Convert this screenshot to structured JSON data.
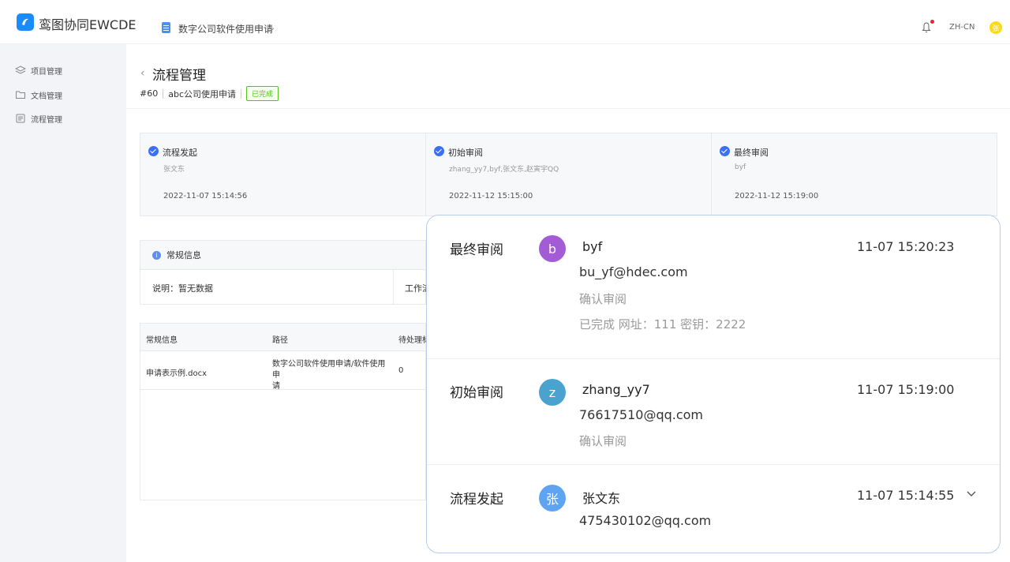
{
  "header": {
    "app_title": "鸾图协同EWCDE",
    "project_name": "数字公司软件使用申请",
    "lang": "ZH-CN",
    "avatar_text": "张"
  },
  "sidebar": {
    "items": [
      {
        "label": "项目管理",
        "icon": "layers-icon"
      },
      {
        "label": "文档管理",
        "icon": "folder-icon"
      },
      {
        "label": "流程管理",
        "icon": "process-icon"
      }
    ]
  },
  "page": {
    "title": "流程管理",
    "id": "#60",
    "name": "abc公司使用申请",
    "status": "已完成"
  },
  "steps": [
    {
      "name": "流程发起",
      "users": "张文东",
      "time": "2022-11-07 15:14:56"
    },
    {
      "name": "初始审阅",
      "users": "zhang_yy7,byf,张文东,赵寅宇QQ",
      "time": "2022-11-12 15:15:00"
    },
    {
      "name": "最终审阅",
      "users": "byf",
      "time": "2022-11-12 15:19:00"
    }
  ],
  "info": {
    "title": "常规信息",
    "desc": "说明：暂无数据",
    "work": "工作流"
  },
  "table": {
    "headers": [
      "常规信息",
      "路径",
      "待处理标"
    ],
    "rows": [
      {
        "name": "申请表示例.docx",
        "path_line1": "数字公司软件使用申请/软件使用申",
        "path_line2": "请",
        "count": "0"
      }
    ]
  },
  "popover": {
    "items": [
      {
        "stage": "最终审阅",
        "avatar": "b",
        "avatar_color": "#a35bd6",
        "user": "byf",
        "time": "11-07 15:20:23",
        "email": "bu_yf@hdec.com",
        "note1": "确认审阅",
        "note2": "已完成 网址：111 密钥：2222"
      },
      {
        "stage": "初始审阅",
        "avatar": "z",
        "avatar_color": "#4aa3cf",
        "user": "zhang_yy7",
        "time": "11-07 15:19:00",
        "email": "76617510@qq.com",
        "note1": "确认审阅"
      },
      {
        "stage": "流程发起",
        "avatar": "张",
        "avatar_color": "#5ea4f0",
        "user": "张文东",
        "time": "11-07 15:14:55",
        "email": "475430102@qq.com"
      }
    ]
  }
}
